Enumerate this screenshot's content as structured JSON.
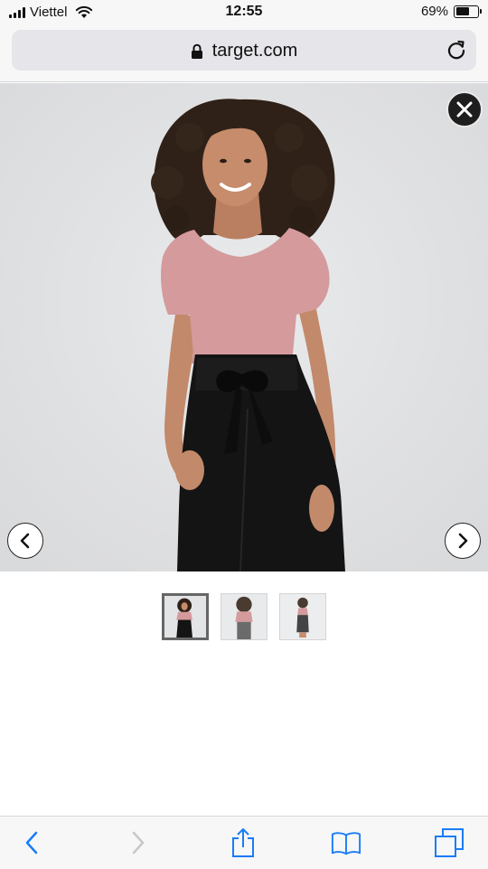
{
  "status_bar": {
    "carrier": "Viettel",
    "time": "12:55",
    "battery_percent": "69%",
    "battery_level": 0.69,
    "signal_bars": 4
  },
  "address_bar": {
    "url": "target.com",
    "secure": true
  },
  "product_gallery": {
    "image_count": 3,
    "selected_index": 0,
    "colors": {
      "background": "#e2e3e5",
      "top": "#d59a9c",
      "pants": "#141414",
      "hair": "#2f2118",
      "skin": "#c68c6c"
    }
  },
  "icons": {
    "close": "close-icon",
    "prev": "chevron-left-icon",
    "next": "chevron-right-icon",
    "back": "back-icon",
    "forward": "forward-icon",
    "share": "share-icon",
    "bookmarks": "bookmarks-icon",
    "tabs": "tabs-icon",
    "reload": "reload-icon",
    "lock": "lock-icon"
  },
  "colors": {
    "ios_blue": "#1a7cf7",
    "disabled": "#c7c7cc"
  }
}
